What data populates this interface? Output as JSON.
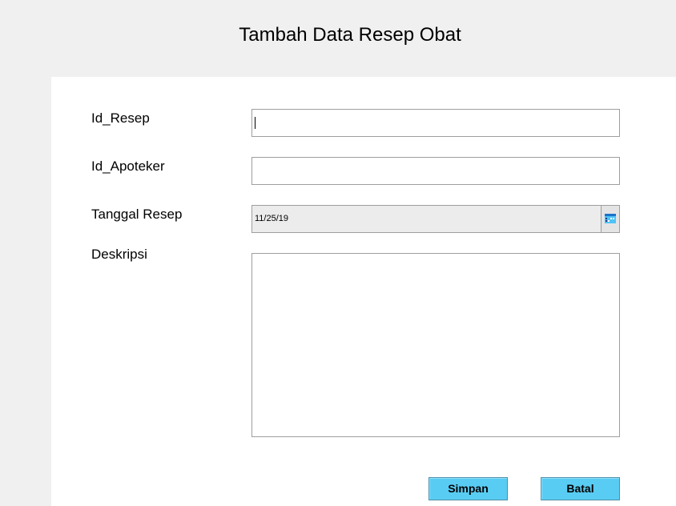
{
  "window": {
    "title": "Tambah Data Resep Obat"
  },
  "form": {
    "id_resep": {
      "label": "Id_Resep",
      "value": ""
    },
    "id_apoteker": {
      "label": "Id_Apoteker",
      "value": ""
    },
    "tanggal_resep": {
      "label": "Tanggal Resep",
      "value": "11/25/19",
      "picker_icon": "calendar-icon"
    },
    "deskripsi": {
      "label": "Deskripsi",
      "value": ""
    }
  },
  "buttons": {
    "save_label": "Simpan",
    "cancel_label": "Batal"
  },
  "colors": {
    "button_bg": "#59ccf3",
    "window_bg": "#f0f0f0",
    "panel_bg": "#ffffff"
  }
}
